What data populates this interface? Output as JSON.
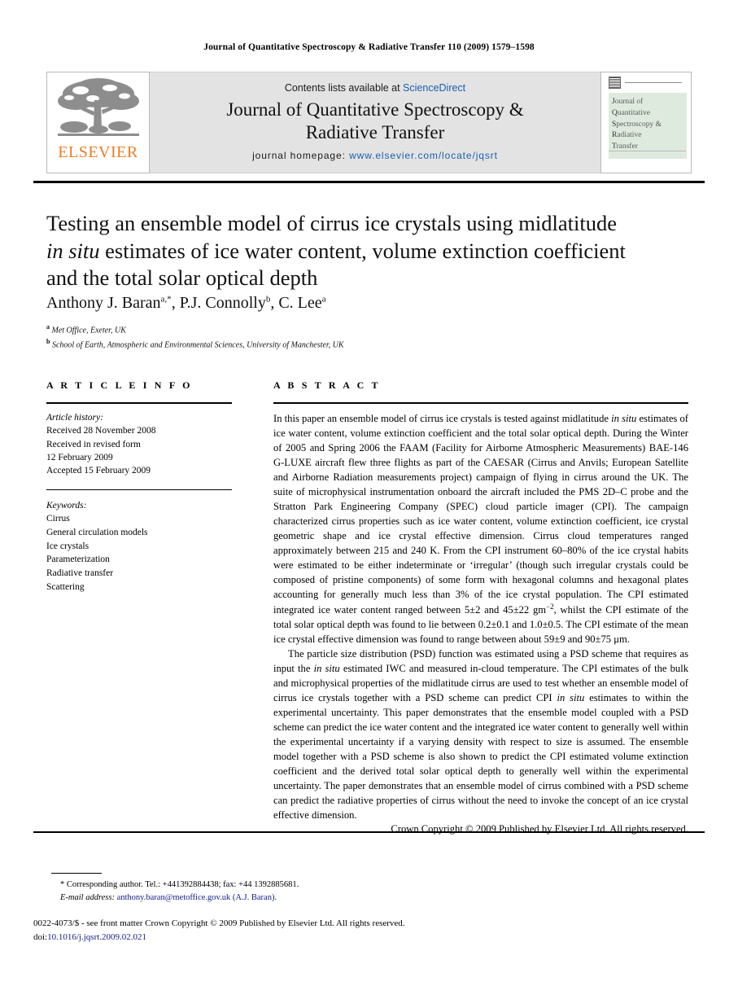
{
  "running_head": "Journal of Quantitative Spectroscopy & Radiative Transfer 110 (2009) 1579–1598",
  "masthead": {
    "publisher_name": "ELSEVIER",
    "contents_prefix": "Contents lists available at ",
    "contents_link": "ScienceDirect",
    "journal_title_line1": "Journal of Quantitative Spectroscopy &",
    "journal_title_line2": "Radiative Transfer",
    "homepage_label": "journal homepage: ",
    "homepage_url": "www.elsevier.com/locate/jqsrt",
    "cover_lines": [
      "ournal of",
      "uantitative",
      "pectroscopy &",
      "adiative",
      "ransfer"
    ],
    "cover_caps": [
      "J",
      "Q",
      "S",
      "R",
      "T"
    ]
  },
  "article": {
    "title_line1": "Testing an ensemble model of cirrus ice crystals using midlatitude",
    "title_line2_italic": "in situ",
    "title_line2_rest": " estimates of ice water content, volume extinction coefficient",
    "title_line3": "and the total solar optical depth",
    "authors": "Anthony J. Baran",
    "author_sup_1": "a,*",
    "authors_2": ", P.J. Connolly",
    "author_sup_2": "b",
    "authors_3": ", C. Lee",
    "author_sup_3": "a",
    "affiliation_a_sup": "a",
    "affiliation_a": "Met Office, Exeter, UK",
    "affiliation_b_sup": "b",
    "affiliation_b": "School of Earth, Atmospheric and Environmental Sciences, University of Manchester, UK"
  },
  "article_info": {
    "heading": "A R T I C L E   I N F O",
    "history_label": "Article history:",
    "history_lines": [
      "Received 28 November 2008",
      "Received in revised form",
      "12 February 2009",
      "Accepted 15 February 2009"
    ],
    "keywords_label": "Keywords:",
    "keywords": [
      "Cirrus",
      "General circulation models",
      "Ice crystals",
      "Parameterization",
      "Radiative transfer",
      "Scattering"
    ]
  },
  "abstract": {
    "heading": "A B S T R A C T",
    "paragraph_1_part1": "In this paper an ensemble model of cirrus ice crystals is tested against midlatitude ",
    "paragraph_1_italic1": "in situ",
    "paragraph_1_part2": " estimates of ice water content, volume extinction coefficient and the total solar optical depth. During the Winter of 2005 and Spring 2006 the FAAM (Facility for Airborne Atmospheric Measurements) BAE-146 G-LUXE aircraft flew three flights as part of the CAESAR (Cirrus and Anvils; European Satellite and Airborne Radiation measurements project) campaign of flying in cirrus around the UK. The suite of microphysical instrumentation onboard the aircraft included the PMS 2D–C probe and the Stratton Park Engineering Company (SPEC) cloud particle imager (CPI). The campaign characterized cirrus properties such as ice water content, volume extinction coefficient, ice crystal geometric shape and ice crystal effective dimension. Cirrus cloud temperatures ranged approximately between 215 and 240 K. From the CPI instrument 60–80% of the ice crystal habits were estimated to be either indeterminate or ‘irregular’ (though such irregular crystals could be composed of pristine components) of some form with hexagonal columns and hexagonal plates accounting for generally much less than 3% of the ice crystal population. The CPI estimated integrated ice water content ranged between 5±2 and 45±22 gm",
    "paragraph_1_sup": "−2",
    "paragraph_1_part3": ", whilst the CPI estimate of the total solar optical depth was found to lie between 0.2±0.1 and 1.0±0.5. The CPI estimate of the mean ice crystal effective dimension was found to range between about 59±9 and 90±75 μm.",
    "paragraph_2_part1": "The particle size distribution (PSD) function was estimated using a PSD scheme that requires as input the ",
    "paragraph_2_italic1": "in situ",
    "paragraph_2_part2": " estimated IWC and measured in-cloud temperature. The CPI estimates of the bulk and microphysical properties of the midlatitude cirrus are used to test whether an ensemble model of cirrus ice crystals together with a PSD scheme can predict CPI ",
    "paragraph_2_italic2": "in situ",
    "paragraph_2_part3": " estimates to within the experimental uncertainty. This paper demonstrates that the ensemble model coupled with a PSD scheme can predict the ice water content and the integrated ice water content to generally well within the experimental uncertainty if a varying density with respect to size is assumed. The ensemble model together with a PSD scheme is also shown to predict the CPI estimated volume extinction coefficient and the derived total solar optical depth to generally well within the experimental uncertainty. The paper demonstrates that an ensemble model of cirrus combined with a PSD scheme can predict the radiative properties of cirrus without the need to invoke the concept of an ice crystal effective dimension.",
    "copyright": "Crown Copyright © 2009 Published by Elsevier Ltd. All rights reserved."
  },
  "footnote": {
    "corresponding": "* Corresponding author. Tel.: +441392884438; fax: +44 1392885681.",
    "email_label": "E-mail address:",
    "email": " anthony.baran@metoffice.gov.uk (A.J. Baran).",
    "issn_line": "0022-4073/$ - see front matter Crown Copyright © 2009 Published by Elsevier Ltd. All rights reserved.",
    "doi_label": "doi:",
    "doi": "10.1016/j.jqsrt.2009.02.021"
  },
  "colors": {
    "link_blue": "#1c5fb0",
    "email_navy": "#16208c",
    "elsevier_orange": "#ee7c24",
    "masthead_grey": "#e3e3e3",
    "cover_green": "#dfeadf"
  }
}
